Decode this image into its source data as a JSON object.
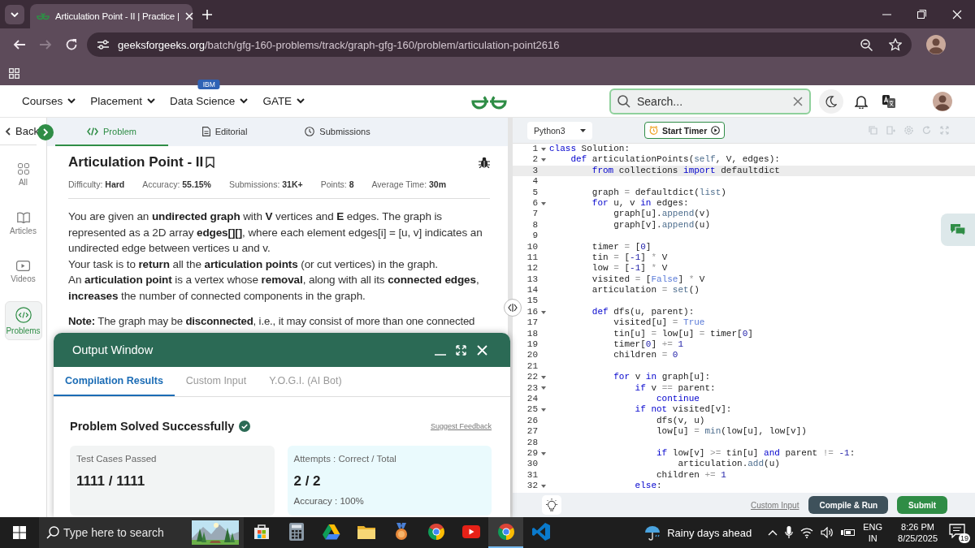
{
  "browser": {
    "tab": {
      "title": "Articulation Point - II | Practice |"
    },
    "nav": [
      {
        "disabled": false
      },
      {
        "disabled": true
      },
      {
        "disabled": false
      }
    ],
    "url": {
      "domain": "geeksforgeeks.org",
      "path": "/batch/gfg-160-problems/track/graph-gfg-160/problem/articulation-point2616"
    }
  },
  "site_header": {
    "nav": [
      {
        "label": "Courses"
      },
      {
        "label": "Placement"
      },
      {
        "label": "Data Science",
        "badge": "IBM"
      },
      {
        "label": "GATE"
      }
    ],
    "search": {
      "placeholder": "Search..."
    }
  },
  "sidebar": {
    "back": "Back",
    "items": [
      {
        "label": "All",
        "selected": false
      },
      {
        "label": "Articles",
        "selected": false
      },
      {
        "label": "Videos",
        "selected": false
      },
      {
        "label": "Problems",
        "selected": true
      }
    ]
  },
  "problem": {
    "tabs": [
      {
        "label": "Problem",
        "selected": true
      },
      {
        "label": "Editorial",
        "selected": false
      },
      {
        "label": "Submissions",
        "selected": false
      }
    ],
    "title": "Articulation Point - II",
    "meta": [
      "Difficulty: **Hard**",
      "Accuracy: **55.15%**",
      "Submissions: **31K+**",
      "Points: **8**",
      "Average Time: **30m**"
    ],
    "paragraphs": [
      "You are given an **undirected graph** with **V** vertices and **E** edges. The graph is represented as a 2D array **edges[][]**, where each element edges[i] = [u, v] indicates an undirected edge between vertices u and v.",
      "Your task is to **return** all the **articulation points** (or cut vertices) in the graph.",
      "An **articulation point** is a vertex whose **removal**, along with all its **connected edges**, **increases** the number of connected components in the graph."
    ],
    "note": "**Note:** The graph may be **disconnected**, i.e., it may consist of more than one connected"
  },
  "output_window": {
    "title": "Output Window",
    "tabs": [
      {
        "label": "Compilation Results",
        "selected": true
      },
      {
        "label": "Custom Input",
        "selected": false
      },
      {
        "label": "Y.O.G.I. (AI Bot)",
        "selected": false
      }
    ],
    "status": "Problem Solved Successfully",
    "feedback_link": "Suggest Feedback",
    "cards": [
      {
        "label": "Test Cases Passed",
        "value": "1111 / 1111"
      },
      {
        "label": "Attempts : Correct / Total",
        "value": "2 / 2",
        "detail": "Accuracy : 100%"
      }
    ]
  },
  "editor": {
    "language": "Python3",
    "timer_button": "Start Timer",
    "lines": [
      {
        "number": "1",
        "foldable": true,
        "highlighted": false,
        "tokens": [
          {
            "text": "class",
            "kind": "keyword"
          },
          {
            "text": " Solution:",
            "kind": "plain"
          }
        ]
      },
      {
        "number": "2",
        "foldable": true,
        "highlighted": false,
        "tokens": [
          {
            "text": "    def",
            "kind": "keyword"
          },
          {
            "text": " articulationPoints(",
            "kind": "plain"
          },
          {
            "text": "self",
            "kind": "builtin"
          },
          {
            "text": ", V, edges):",
            "kind": "plain"
          }
        ]
      },
      {
        "number": "3",
        "foldable": false,
        "highlighted": true,
        "tokens": [
          {
            "text": "        from",
            "kind": "keyword"
          },
          {
            "text": " collections ",
            "kind": "plain"
          },
          {
            "text": "import",
            "kind": "keyword"
          },
          {
            "text": " defaultdict",
            "kind": "plain"
          }
        ]
      },
      {
        "number": "4",
        "foldable": false,
        "highlighted": false
      },
      {
        "number": "5",
        "foldable": false,
        "highlighted": false,
        "tokens": [
          {
            "text": "        graph ",
            "kind": "plain"
          },
          {
            "text": "=",
            "kind": "operator"
          },
          {
            "text": " defaultdict(",
            "kind": "plain"
          },
          {
            "text": "list",
            "kind": "builtin"
          },
          {
            "text": ")",
            "kind": "plain"
          }
        ]
      },
      {
        "number": "6",
        "foldable": true,
        "highlighted": false,
        "tokens": [
          {
            "text": "        for",
            "kind": "keyword"
          },
          {
            "text": " u, v ",
            "kind": "plain"
          },
          {
            "text": "in",
            "kind": "keyword"
          },
          {
            "text": " edges:",
            "kind": "plain"
          }
        ]
      },
      {
        "number": "7",
        "foldable": false,
        "highlighted": false,
        "tokens": [
          {
            "text": "            graph[u].",
            "kind": "plain"
          },
          {
            "text": "append",
            "kind": "builtin"
          },
          {
            "text": "(v)",
            "kind": "plain"
          }
        ]
      },
      {
        "number": "8",
        "foldable": false,
        "highlighted": false,
        "tokens": [
          {
            "text": "            graph[v].",
            "kind": "plain"
          },
          {
            "text": "append",
            "kind": "builtin"
          },
          {
            "text": "(u)",
            "kind": "plain"
          }
        ]
      },
      {
        "number": "9",
        "foldable": false,
        "highlighted": false
      },
      {
        "number": "10",
        "foldable": false,
        "highlighted": false,
        "tokens": [
          {
            "text": "        timer ",
            "kind": "plain"
          },
          {
            "text": "=",
            "kind": "operator"
          },
          {
            "text": " [",
            "kind": "plain"
          },
          {
            "text": "0",
            "kind": "number"
          },
          {
            "text": "]",
            "kind": "plain"
          }
        ]
      },
      {
        "number": "11",
        "foldable": false,
        "highlighted": false,
        "tokens": [
          {
            "text": "        tin ",
            "kind": "plain"
          },
          {
            "text": "=",
            "kind": "operator"
          },
          {
            "text": " [",
            "kind": "plain"
          },
          {
            "text": "-1",
            "kind": "number"
          },
          {
            "text": "] ",
            "kind": "plain"
          },
          {
            "text": "*",
            "kind": "operator"
          },
          {
            "text": " V",
            "kind": "plain"
          }
        ]
      },
      {
        "number": "12",
        "foldable": false,
        "highlighted": false,
        "tokens": [
          {
            "text": "        low ",
            "kind": "plain"
          },
          {
            "text": "=",
            "kind": "operator"
          },
          {
            "text": " [",
            "kind": "plain"
          },
          {
            "text": "-1",
            "kind": "number"
          },
          {
            "text": "] ",
            "kind": "plain"
          },
          {
            "text": "*",
            "kind": "operator"
          },
          {
            "text": " V",
            "kind": "plain"
          }
        ]
      },
      {
        "number": "13",
        "foldable": false,
        "highlighted": false,
        "tokens": [
          {
            "text": "        visited ",
            "kind": "plain"
          },
          {
            "text": "=",
            "kind": "operator"
          },
          {
            "text": " [",
            "kind": "plain"
          },
          {
            "text": "False",
            "kind": "constant"
          },
          {
            "text": "] ",
            "kind": "plain"
          },
          {
            "text": "*",
            "kind": "operator"
          },
          {
            "text": " V",
            "kind": "plain"
          }
        ]
      },
      {
        "number": "14",
        "foldable": false,
        "highlighted": false,
        "tokens": [
          {
            "text": "        articulation ",
            "kind": "plain"
          },
          {
            "text": "= ",
            "kind": "operator"
          },
          {
            "text": "set",
            "kind": "builtin"
          },
          {
            "text": "()",
            "kind": "plain"
          }
        ]
      },
      {
        "number": "15",
        "foldable": false,
        "highlighted": false
      },
      {
        "number": "16",
        "foldable": true,
        "highlighted": false,
        "tokens": [
          {
            "text": "        def",
            "kind": "keyword"
          },
          {
            "text": " dfs(u, parent):",
            "kind": "plain"
          }
        ]
      },
      {
        "number": "17",
        "foldable": false,
        "highlighted": false,
        "tokens": [
          {
            "text": "            visited[u] ",
            "kind": "plain"
          },
          {
            "text": "= ",
            "kind": "operator"
          },
          {
            "text": "True",
            "kind": "constant"
          }
        ]
      },
      {
        "number": "18",
        "foldable": false,
        "highlighted": false,
        "tokens": [
          {
            "text": "            tin[u] ",
            "kind": "plain"
          },
          {
            "text": "=",
            "kind": "operator"
          },
          {
            "text": " low[u] ",
            "kind": "plain"
          },
          {
            "text": "=",
            "kind": "operator"
          },
          {
            "text": " timer[",
            "kind": "plain"
          },
          {
            "text": "0",
            "kind": "number"
          },
          {
            "text": "]",
            "kind": "plain"
          }
        ]
      },
      {
        "number": "19",
        "foldable": false,
        "highlighted": false,
        "tokens": [
          {
            "text": "            timer[",
            "kind": "plain"
          },
          {
            "text": "0",
            "kind": "number"
          },
          {
            "text": "] ",
            "kind": "plain"
          },
          {
            "text": "+= ",
            "kind": "operator"
          },
          {
            "text": "1",
            "kind": "number"
          }
        ]
      },
      {
        "number": "20",
        "foldable": false,
        "highlighted": false,
        "tokens": [
          {
            "text": "            children ",
            "kind": "plain"
          },
          {
            "text": "= ",
            "kind": "operator"
          },
          {
            "text": "0",
            "kind": "number"
          }
        ]
      },
      {
        "number": "21",
        "foldable": false,
        "highlighted": false
      },
      {
        "number": "22",
        "foldable": true,
        "highlighted": false,
        "tokens": [
          {
            "text": "            for",
            "kind": "keyword"
          },
          {
            "text": " v ",
            "kind": "plain"
          },
          {
            "text": "in",
            "kind": "keyword"
          },
          {
            "text": " graph[u]:",
            "kind": "plain"
          }
        ]
      },
      {
        "number": "23",
        "foldable": true,
        "highlighted": false,
        "tokens": [
          {
            "text": "                if",
            "kind": "keyword"
          },
          {
            "text": " v ",
            "kind": "plain"
          },
          {
            "text": "==",
            "kind": "operator"
          },
          {
            "text": " parent:",
            "kind": "plain"
          }
        ]
      },
      {
        "number": "24",
        "foldable": false,
        "highlighted": false,
        "tokens": [
          {
            "text": "                    continue",
            "kind": "keyword"
          }
        ]
      },
      {
        "number": "25",
        "foldable": true,
        "highlighted": false,
        "tokens": [
          {
            "text": "                if not",
            "kind": "keyword"
          },
          {
            "text": " visited[v]:",
            "kind": "plain"
          }
        ]
      },
      {
        "number": "26",
        "foldable": false,
        "highlighted": false,
        "tokens": [
          {
            "text": "                    dfs(v, u)",
            "kind": "plain"
          }
        ]
      },
      {
        "number": "27",
        "foldable": false,
        "highlighted": false,
        "tokens": [
          {
            "text": "                    low[u] ",
            "kind": "plain"
          },
          {
            "text": "= ",
            "kind": "operator"
          },
          {
            "text": "min",
            "kind": "builtin"
          },
          {
            "text": "(low[u], low[v])",
            "kind": "plain"
          }
        ]
      },
      {
        "number": "28",
        "foldable": false,
        "highlighted": false
      },
      {
        "number": "29",
        "foldable": true,
        "highlighted": false,
        "tokens": [
          {
            "text": "                    if",
            "kind": "keyword"
          },
          {
            "text": " low[v] ",
            "kind": "plain"
          },
          {
            "text": ">=",
            "kind": "operator"
          },
          {
            "text": " tin[u] ",
            "kind": "plain"
          },
          {
            "text": "and",
            "kind": "keyword"
          },
          {
            "text": " parent ",
            "kind": "plain"
          },
          {
            "text": "!= ",
            "kind": "operator"
          },
          {
            "text": "-1",
            "kind": "number"
          },
          {
            "text": ":",
            "kind": "plain"
          }
        ]
      },
      {
        "number": "30",
        "foldable": false,
        "highlighted": false,
        "tokens": [
          {
            "text": "                        articulation.",
            "kind": "plain"
          },
          {
            "text": "add",
            "kind": "builtin"
          },
          {
            "text": "(u)",
            "kind": "plain"
          }
        ]
      },
      {
        "number": "31",
        "foldable": false,
        "highlighted": false,
        "tokens": [
          {
            "text": "                    children ",
            "kind": "plain"
          },
          {
            "text": "+= ",
            "kind": "operator"
          },
          {
            "text": "1",
            "kind": "number"
          }
        ]
      },
      {
        "number": "32",
        "foldable": true,
        "highlighted": false,
        "tokens": [
          {
            "text": "                else",
            "kind": "keyword"
          },
          {
            "text": ":",
            "kind": "plain"
          }
        ]
      }
    ],
    "footer": {
      "custom_input": "Custom Input",
      "compile": "Compile & Run",
      "submit": "Submit"
    }
  },
  "taskbar": {
    "search": {
      "placeholder": "Type here to search"
    },
    "apps": [
      {
        "selected": false
      },
      {
        "selected": false
      },
      {
        "selected": false
      },
      {
        "selected": false
      },
      {
        "selected": false
      },
      {
        "selected": false
      },
      {
        "selected": false
      },
      {
        "selected": true
      },
      {
        "selected": false
      }
    ],
    "weather": "Rainy days ahead",
    "language": "ENG",
    "region": "IN",
    "time": "8:26 PM",
    "date": "8/25/2025",
    "notifications": "19"
  }
}
